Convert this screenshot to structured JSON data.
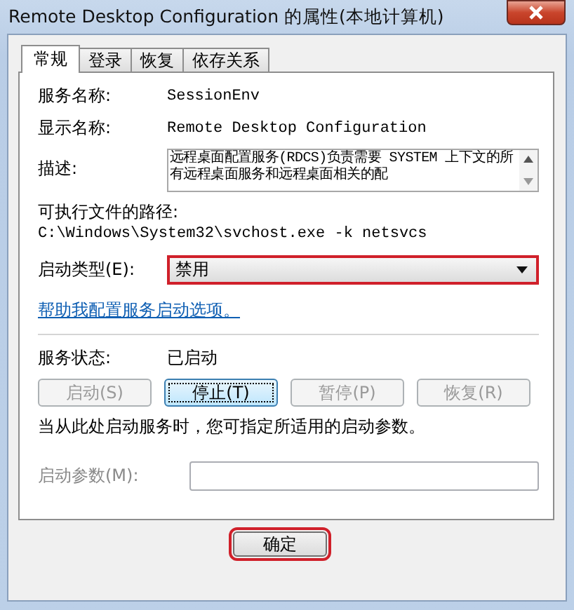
{
  "window": {
    "title": "Remote Desktop Configuration 的属性(本地计算机)"
  },
  "tabs": [
    {
      "label": "常规",
      "selected": true
    },
    {
      "label": "登录",
      "selected": false
    },
    {
      "label": "恢复",
      "selected": false
    },
    {
      "label": "依存关系",
      "selected": false
    }
  ],
  "service_name": {
    "label": "服务名称:",
    "value": "SessionEnv"
  },
  "display_name": {
    "label": "显示名称:",
    "value": "Remote Desktop Configuration"
  },
  "description": {
    "label": "描述:",
    "value": "远程桌面配置服务(RDCS)负责需要 SYSTEM 上下文的所有远程桌面服务和远程桌面相关的配"
  },
  "path": {
    "label": "可执行文件的路径:",
    "value": "C:\\Windows\\System32\\svchost.exe -k netsvcs"
  },
  "startup_type": {
    "label": "启动类型(E):",
    "value": "禁用",
    "highlighted": true
  },
  "help_link": "帮助我配置服务启动选项。",
  "service_status": {
    "label": "服务状态:",
    "value": "已启动"
  },
  "service_buttons": [
    {
      "label": "启动(S)",
      "disabled": true,
      "focused": false
    },
    {
      "label": "停止(T)",
      "disabled": false,
      "focused": true
    },
    {
      "label": "暂停(P)",
      "disabled": true,
      "focused": false
    },
    {
      "label": "恢复(R)",
      "disabled": true,
      "focused": false
    }
  ],
  "hint": "当从此处启动服务时，您可指定所适用的启动参数。",
  "start_params": {
    "label": "启动参数(M):",
    "disabled": true
  },
  "buttons": [
    {
      "label": "确定",
      "highlighted": true
    }
  ]
}
